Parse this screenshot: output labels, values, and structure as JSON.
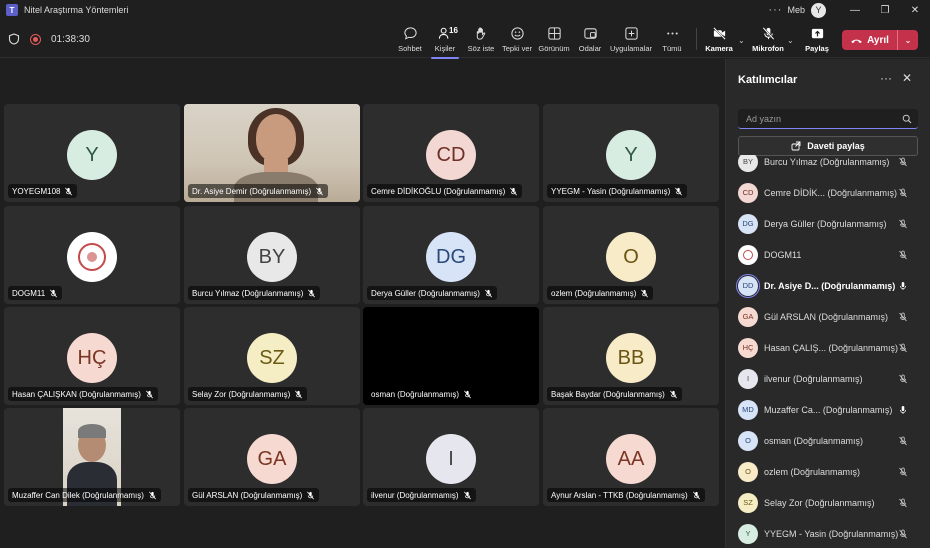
{
  "window": {
    "title": "Nitel Araştırma Yöntemleri",
    "user_name": "Meb",
    "user_initial": "Y",
    "more_label": "···",
    "minimize": "—",
    "restore": "❐",
    "close": "✕"
  },
  "toolbar": {
    "timer": "01:38:30",
    "people_count": "16",
    "buttons": {
      "chat": "Sohbet",
      "people": "Kişiler",
      "raise": "Söz iste",
      "react": "Tepki ver",
      "view": "Görünüm",
      "rooms": "Odalar",
      "apps": "Uygulamalar",
      "more": "Tümü",
      "camera": "Kamera",
      "mic": "Mikrofon",
      "share": "Paylaş"
    },
    "leave_label": "Ayrıl",
    "chevron": "⌄"
  },
  "colors": {
    "accent": "#7f85f5",
    "leave": "#c4314b",
    "background": "#1f1f1f",
    "panel": "#292929"
  },
  "tiles": [
    {
      "name": "YOYEGM108",
      "initials": "Y",
      "bg": "#d8ede2",
      "fg": "#2f5a43",
      "type": "avatar"
    },
    {
      "name": "Dr. Asiye Demir (Doğrulanmamış)",
      "type": "video-woman",
      "speaking": true
    },
    {
      "name": "Cemre DİDİKOĞLU (Doğrulanmamış)",
      "initials": "CD",
      "bg": "#f3d7d3",
      "fg": "#6e2f26",
      "type": "avatar"
    },
    {
      "name": "YYEGM - Yasin (Doğrulanmamış)",
      "initials": "Y",
      "bg": "#d8ede2",
      "fg": "#2f5a43",
      "type": "avatar"
    },
    {
      "name": "DOGM11",
      "type": "logo"
    },
    {
      "name": "Burcu Yılmaz (Doğrulanmamış)",
      "initials": "BY",
      "bg": "#e8e8e8",
      "fg": "#444",
      "type": "avatar"
    },
    {
      "name": "Derya Güller (Doğrulanmamış)",
      "initials": "DG",
      "bg": "#d7e3f6",
      "fg": "#2a4a7a",
      "type": "avatar"
    },
    {
      "name": "ozlem (Doğrulanmamış)",
      "initials": "O",
      "bg": "#f7ebc8",
      "fg": "#6b5414",
      "type": "avatar"
    },
    {
      "name": "Hasan ÇALIŞKAN (Doğrulanmamış)",
      "initials": "HÇ",
      "bg": "#f6d9d0",
      "fg": "#7a3524",
      "type": "avatar"
    },
    {
      "name": "Selay Zor (Doğrulanmamış)",
      "initials": "SZ",
      "bg": "#f5eec4",
      "fg": "#6b5a14",
      "type": "avatar"
    },
    {
      "name": "osman (Doğrulanmamış)",
      "type": "dark"
    },
    {
      "name": "Başak Baydar (Doğrulanmamış)",
      "initials": "BB",
      "bg": "#f7ebc8",
      "fg": "#6b5414",
      "type": "avatar"
    },
    {
      "name": "Muzaffer Can Dilek (Doğrulanmamış)",
      "type": "video-man"
    },
    {
      "name": "Gül ARSLAN (Doğrulanmamış)",
      "initials": "GA",
      "bg": "#f6d9d0",
      "fg": "#7a3524",
      "type": "avatar"
    },
    {
      "name": "ilvenur (Doğrulanmamış)",
      "initials": "I",
      "bg": "#e6e6ee",
      "fg": "#444",
      "type": "avatar"
    },
    {
      "name": "Aynur Arslan - TTKB (Doğrulanmamış)",
      "initials": "AA",
      "bg": "#f6d9d0",
      "fg": "#7a3524",
      "type": "avatar"
    }
  ],
  "panel": {
    "title": "Katılımcılar",
    "more": "···",
    "close": "✕",
    "search_placeholder": "Ad yazın",
    "share_invite": "Daveti paylaş",
    "participants": [
      {
        "initials": "BY",
        "name": "Burcu Yılmaz (Doğrulanmamış)",
        "bg": "#e8e8e8",
        "fg": "#444",
        "mic": "off"
      },
      {
        "initials": "CD",
        "name": "Cemre DİDİK...  (Doğrulanmamış)",
        "bg": "#f3d7d3",
        "fg": "#6e2f26",
        "mic": "off"
      },
      {
        "initials": "DG",
        "name": "Derya Güller (Doğrulanmamış)",
        "bg": "#d7e3f6",
        "fg": "#2a4a7a",
        "mic": "off"
      },
      {
        "initials": "",
        "name": "DOGM11",
        "bg": "#ffffff",
        "fg": "#c54b4b",
        "mic": "off",
        "logo": true
      },
      {
        "initials": "DD",
        "name": "Dr. Asiye D...   (Doğrulanmamış)",
        "bg": "#d7e3f6",
        "fg": "#2a4a7a",
        "mic": "on",
        "bold": true
      },
      {
        "initials": "GA",
        "name": "Gül ARSLAN (Doğrulanmamış)",
        "bg": "#f6d9d0",
        "fg": "#7a3524",
        "mic": "off"
      },
      {
        "initials": "HÇ",
        "name": "Hasan ÇALIŞ...  (Doğrulanmamış)",
        "bg": "#f6d9d0",
        "fg": "#7a3524",
        "mic": "off"
      },
      {
        "initials": "I",
        "name": "ilvenur (Doğrulanmamış)",
        "bg": "#e6e6ee",
        "fg": "#444",
        "mic": "off"
      },
      {
        "initials": "MD",
        "name": "Muzaffer Ca...  (Doğrulanmamış)",
        "bg": "#d7e3f6",
        "fg": "#2a4a7a",
        "mic": "on"
      },
      {
        "initials": "O",
        "name": "osman (Doğrulanmamış)",
        "bg": "#d7e3f6",
        "fg": "#2a4a7a",
        "mic": "off"
      },
      {
        "initials": "O",
        "name": "ozlem (Doğrulanmamış)",
        "bg": "#f7ebc8",
        "fg": "#6b5414",
        "mic": "off"
      },
      {
        "initials": "SZ",
        "name": "Selay Zor (Doğrulanmamış)",
        "bg": "#f5eec4",
        "fg": "#6b5a14",
        "mic": "off"
      },
      {
        "initials": "Y",
        "name": "YYEGM - Yasin (Doğrulanmamış)",
        "bg": "#d8ede2",
        "fg": "#2f5a43",
        "mic": "off"
      }
    ]
  }
}
